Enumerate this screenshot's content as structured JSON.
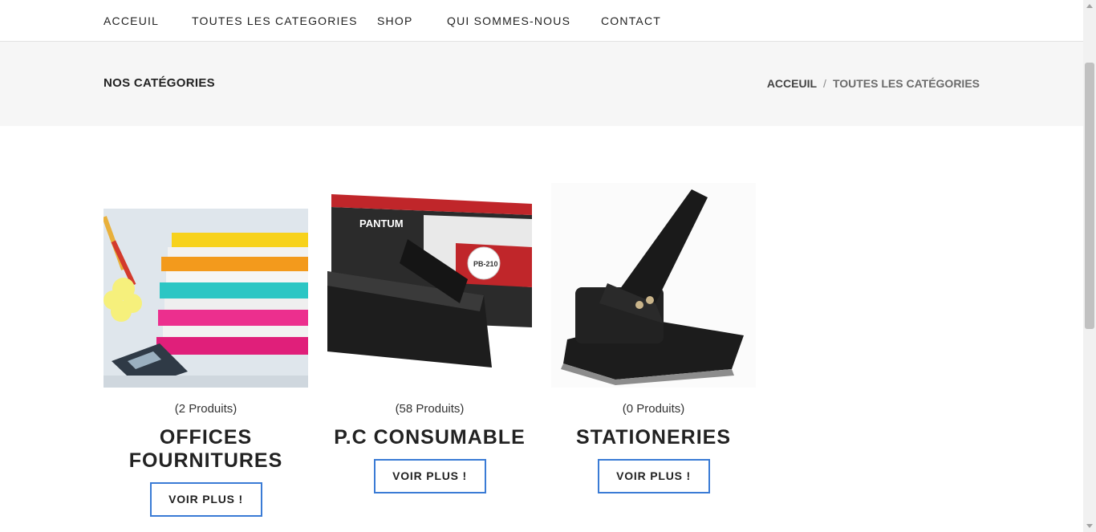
{
  "nav": {
    "items": [
      {
        "label": "ACCEUIL"
      },
      {
        "label": "TOUTES LES CATEGORIES"
      },
      {
        "label": "SHOP"
      },
      {
        "label": "QUI SOMMES-NOUS"
      },
      {
        "label": "CONTACT"
      }
    ]
  },
  "header": {
    "title": "NOS CATÉGORIES",
    "breadcrumb": {
      "home": "ACCEUIL",
      "separator": "/",
      "current": "TOUTES LES CATÉGORIES"
    }
  },
  "categories": [
    {
      "count": "(2 Produits)",
      "name": "OFFICES FOURNITURES",
      "button": "VOIR PLUS !",
      "image": "office-supplies-image"
    },
    {
      "count": "(58 Produits)",
      "name": "P.C CONSUMABLE",
      "button": "VOIR PLUS !",
      "image": "toner-cartridge-image",
      "brand_text": "PANTUM",
      "model_text": "PB-210"
    },
    {
      "count": "(0 Produits)",
      "name": "STATIONERIES",
      "button": "VOIR PLUS !",
      "image": "hole-punch-image"
    }
  ],
  "colors": {
    "button_border": "#3a7bd5",
    "band_background": "#f6f6f6",
    "text": "#222222"
  }
}
